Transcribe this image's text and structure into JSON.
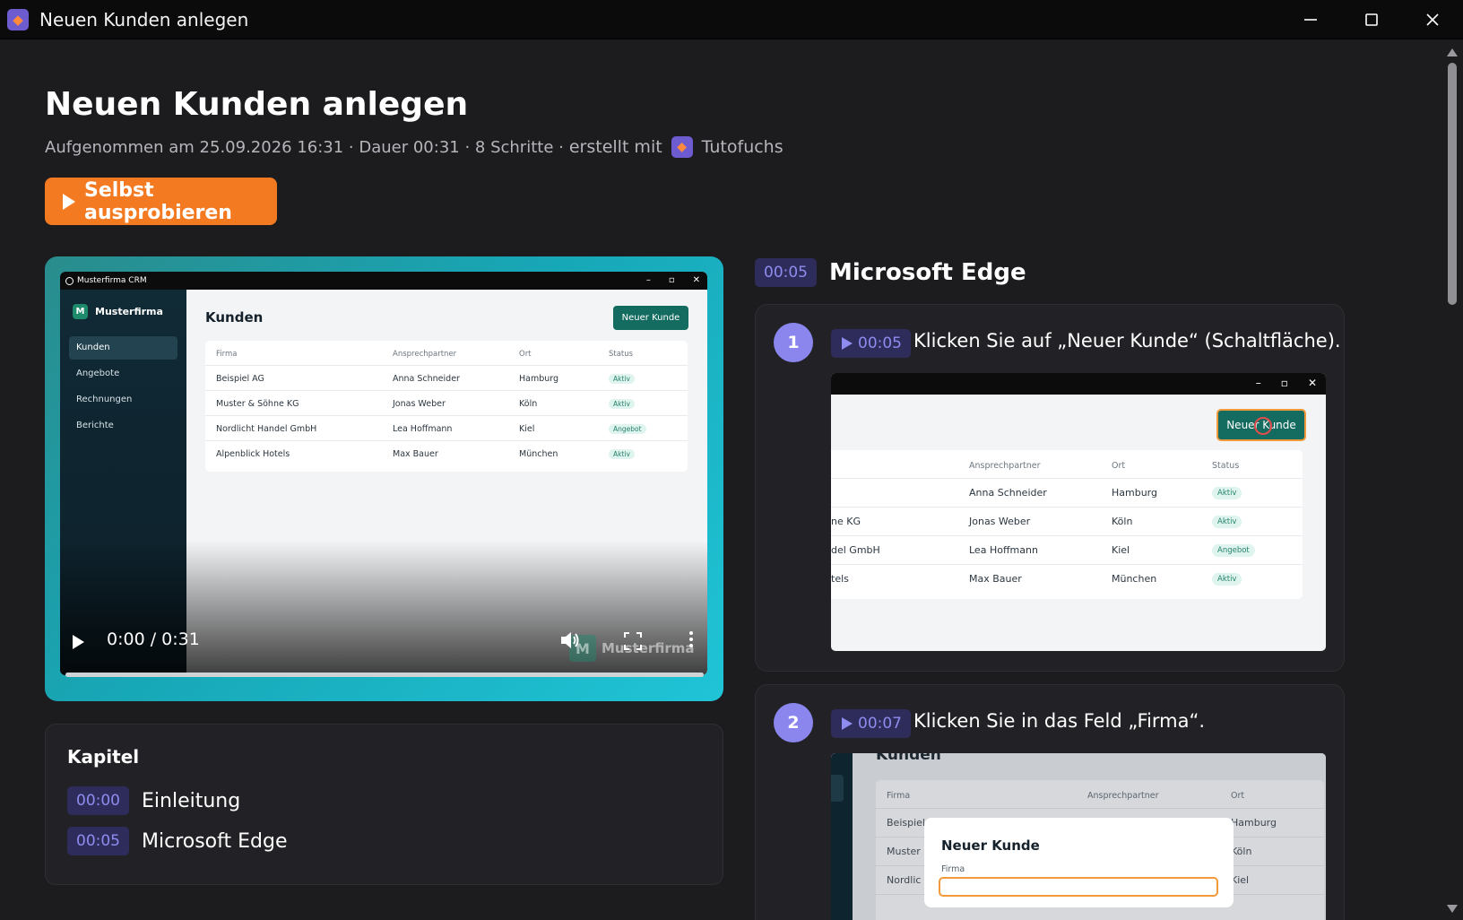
{
  "window": {
    "title": "Neuen Kunden anlegen"
  },
  "page": {
    "title": "Neuen Kunden anlegen",
    "meta": "Aufgenommen am 25.09.2026 16:31 · Dauer 00:31 · 8 Schritte ·",
    "made_with": "erstellt mit",
    "brand": "Tutofuchs",
    "try_button": "Selbst ausprobieren"
  },
  "video": {
    "app_title": "Musterfirma CRM",
    "logo_letter": "M",
    "logo_name": "Musterfirma",
    "nav": [
      "Kunden",
      "Angebote",
      "Rechnungen",
      "Berichte"
    ],
    "heading": "Kunden",
    "new_button": "Neuer Kunde",
    "columns": [
      "Firma",
      "Ansprechpartner",
      "Ort",
      "Status"
    ],
    "rows": [
      [
        "Beispiel AG",
        "Anna Schneider",
        "Hamburg",
        "Aktiv"
      ],
      [
        "Muster & Söhne KG",
        "Jonas Weber",
        "Köln",
        "Aktiv"
      ],
      [
        "Nordlicht Handel GmbH",
        "Lea Hoffmann",
        "Kiel",
        "Angebot"
      ],
      [
        "Alpenblick Hotels",
        "Max Bauer",
        "München",
        "Aktiv"
      ]
    ],
    "time": "0:00 / 0:31",
    "watermark": "Musterfirma",
    "progress": 0
  },
  "chapters": {
    "title": "Kapitel",
    "items": [
      {
        "time": "00:00",
        "label": "Einleitung"
      },
      {
        "time": "00:05",
        "label": "Microsoft Edge"
      }
    ]
  },
  "section": {
    "time": "00:05",
    "title": "Microsoft Edge"
  },
  "steps": [
    {
      "num": "1",
      "time": "00:05",
      "text": "Klicken Sie auf „Neuer Kunde“ (Schaltfläche).",
      "shot": {
        "button": "Neuer Kunde",
        "columns": [
          "Ansprechpartner",
          "Ort",
          "Status"
        ],
        "rows": [
          [
            "",
            "Anna Schneider",
            "Hamburg",
            "Aktiv"
          ],
          [
            "ne KG",
            "Jonas Weber",
            "Köln",
            "Aktiv"
          ],
          [
            "del GmbH",
            "Lea Hoffmann",
            "Kiel",
            "Angebot"
          ],
          [
            "tels",
            "Max Bauer",
            "München",
            "Aktiv"
          ]
        ]
      }
    },
    {
      "num": "2",
      "time": "00:07",
      "text": "Klicken Sie in das Feld „Firma“.",
      "shot": {
        "heading": "Kunden",
        "columns": [
          "Firma",
          "Ansprechpartner",
          "Ort"
        ],
        "rows": [
          [
            "Beispiel",
            "Hamburg"
          ],
          [
            "Muster",
            "Köln"
          ],
          [
            "Nordlic",
            "Kiel"
          ]
        ],
        "modal_title": "Neuer Kunde",
        "field_label": "Firma"
      }
    }
  ],
  "colors": {
    "accent": "#f47a22",
    "step_badge": "#8b86ee",
    "timestamp_bg": "#2e2c5a",
    "timestamp_text": "#8f8cf0"
  },
  "icons": {
    "app": "fox-icon",
    "minimize": "minimize-icon",
    "maximize": "maximize-icon",
    "close": "close-icon"
  }
}
